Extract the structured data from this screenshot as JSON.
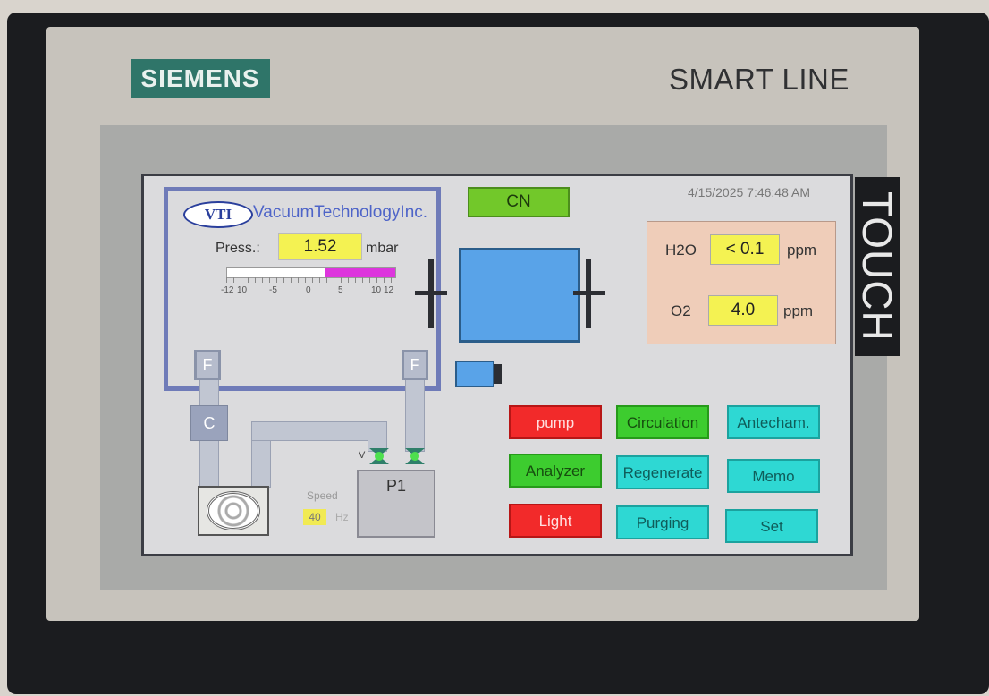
{
  "device": {
    "brand": "SIEMENS",
    "model": "SMART LINE",
    "touch_label": "TOUCH"
  },
  "screen": {
    "cn_button": "CN",
    "datetime": "4/15/2025 7:46:48 AM",
    "vti": {
      "logo": "VTI",
      "name": "VacuumTechnologyInc."
    },
    "pressure": {
      "label": "Press.:",
      "value": "1.52",
      "unit": "mbar",
      "bar_ticks": [
        "-12",
        "10",
        "-5",
        "0",
        "5",
        "10",
        "12"
      ],
      "bar_range": [
        -12,
        12
      ],
      "bar_fill_range": [
        2,
        12
      ]
    },
    "diagram": {
      "filter_left": "F",
      "filter_right": "F",
      "c_label": "C",
      "pump_label": "P1",
      "valve_label": "V",
      "speed_label": "Speed",
      "speed_value": "40",
      "speed_unit": "Hz"
    },
    "gas": {
      "h2o_label": "H2O",
      "h2o_value": "< 0.1",
      "h2o_unit": "ppm",
      "o2_label": "O2",
      "o2_value": "4.0",
      "o2_unit": "ppm"
    },
    "buttons": {
      "pump": "pump",
      "circulation": "Circulation",
      "antecham": "Antecham.",
      "analyzer": "Analyzer",
      "regenerate": "Regenerate",
      "memo": "Memo",
      "light": "Light",
      "purging": "Purging",
      "set": "Set"
    },
    "colors": {
      "red_button": "#f22a2a",
      "green_button": "#3dcc2f",
      "cyan_button": "#2ed8d3",
      "value_field": "#f4f252"
    }
  }
}
